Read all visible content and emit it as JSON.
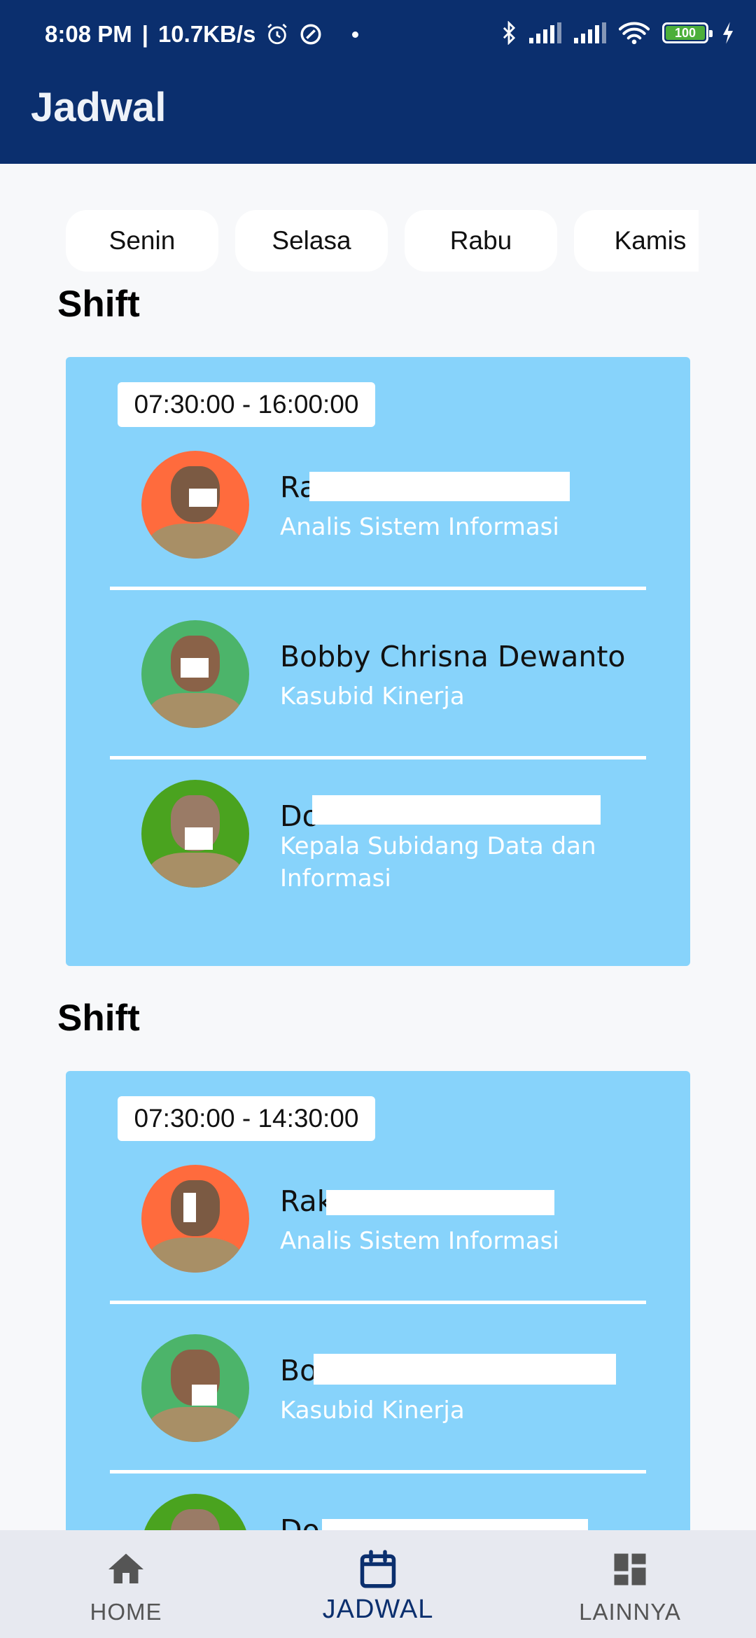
{
  "status_bar": {
    "time": "8:08 PM",
    "net_speed": "10.7KB/s",
    "battery": "100"
  },
  "app_bar": {
    "title": "Jadwal"
  },
  "days": [
    "Senin",
    "Selasa",
    "Rabu",
    "Kamis"
  ],
  "shifts": [
    {
      "label": "Shift",
      "time": "07:30:00 - 16:00:00",
      "people": [
        {
          "name": "Ra",
          "role": "Analis Sistem Informasi"
        },
        {
          "name": "Bobby Chrisna Dewanto",
          "role": "Kasubid Kinerja"
        },
        {
          "name": "Do",
          "role": "Kepala Subidang Data dan Informasi"
        }
      ]
    },
    {
      "label": "Shift",
      "time": "07:30:00 - 14:30:00",
      "people": [
        {
          "name": "Rak",
          "role": "Analis Sistem Informasi"
        },
        {
          "name": "Bo",
          "role": "Kasubid Kinerja"
        },
        {
          "name": "Do",
          "role": ""
        }
      ]
    }
  ],
  "bottom_nav": [
    {
      "label": "HOME",
      "icon": "home-icon"
    },
    {
      "label": "JADWAL",
      "icon": "calendar-icon"
    },
    {
      "label": "LAINNYA",
      "icon": "dashboard-icon"
    }
  ],
  "colors": {
    "app_bar": "#0b2f6e",
    "card": "#87d3fb",
    "avatar_orange": "#ff6b3d",
    "avatar_green": "#4cb46a",
    "avatar_darkgreen": "#4aa31f"
  }
}
